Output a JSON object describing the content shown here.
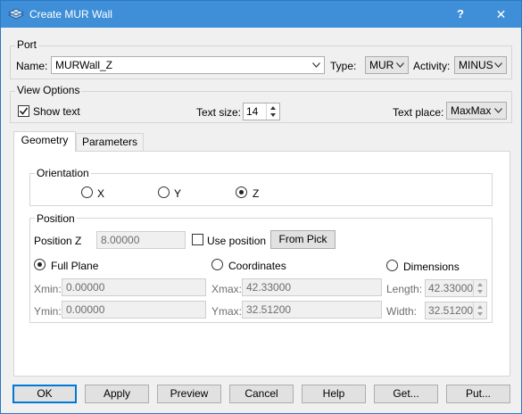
{
  "window": {
    "title": "Create MUR Wall",
    "help_label": "?",
    "close_label": "✕"
  },
  "port": {
    "group_title": "Port",
    "name_label": "Name:",
    "name_value": "MURWall_Z",
    "type_label": "Type:",
    "type_value": "MUR",
    "activity_label": "Activity:",
    "activity_value": "MINUS"
  },
  "view_options": {
    "group_title": "View Options",
    "show_text_label": "Show text",
    "show_text_checked": true,
    "text_size_label": "Text size:",
    "text_size_value": "14",
    "text_place_label": "Text place:",
    "text_place_value": "MaxMax"
  },
  "tabs": [
    {
      "label": "Geometry",
      "active": true
    },
    {
      "label": "Parameters",
      "active": false
    }
  ],
  "orientation": {
    "group_title": "Orientation",
    "options": [
      {
        "label": "X",
        "selected": false
      },
      {
        "label": "Y",
        "selected": false
      },
      {
        "label": "Z",
        "selected": true
      }
    ]
  },
  "position": {
    "group_title": "Position",
    "position_z_label": "Position Z",
    "position_z_value": "8.00000",
    "use_position_label": "Use position",
    "from_pick_label": "From Pick",
    "modes": [
      {
        "label": "Full Plane",
        "selected": true
      },
      {
        "label": "Coordinates",
        "selected": false
      },
      {
        "label": "Dimensions",
        "selected": false
      }
    ],
    "xmin_label": "Xmin:",
    "xmin_value": "0.00000",
    "ymin_label": "Ymin:",
    "ymin_value": "0.00000",
    "xmax_label": "Xmax:",
    "xmax_value": "42.33000",
    "ymax_label": "Ymax:",
    "ymax_value": "32.51200",
    "length_label": "Length:",
    "length_value": "42.33000",
    "width_label": "Width:",
    "width_value": "32.51200"
  },
  "buttons": {
    "ok": "OK",
    "apply": "Apply",
    "preview": "Preview",
    "cancel": "Cancel",
    "help": "Help",
    "get": "Get...",
    "put": "Put..."
  },
  "colors": {
    "titlebar": "#3f8fd8",
    "default_button_border": "#0078d7",
    "dialog_bg": "#f0f0f0"
  }
}
